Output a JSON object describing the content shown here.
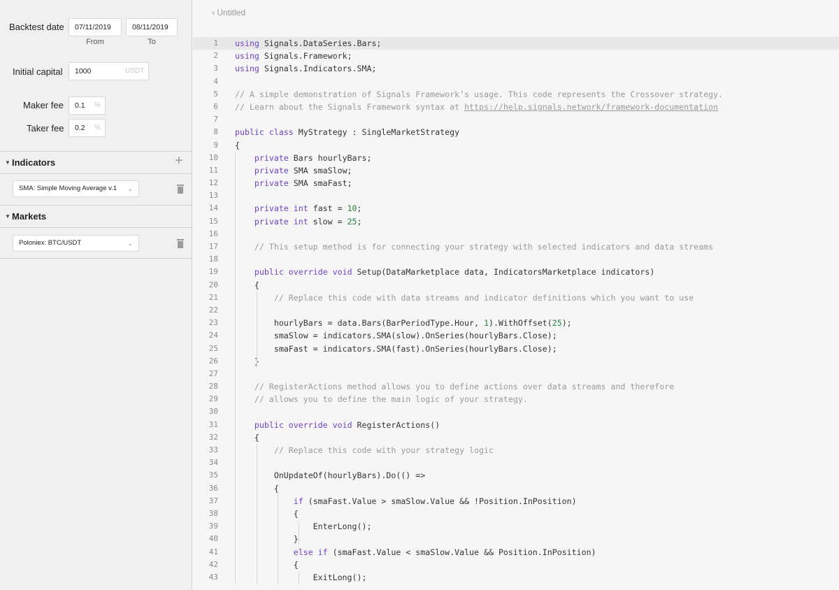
{
  "sidebar": {
    "backtest": {
      "label": "Backtest date",
      "from_value": "07/11/2019",
      "to_value": "08/11/2019",
      "from_sub": "From",
      "to_sub": "To"
    },
    "capital": {
      "label": "Initial capital",
      "value": "1000",
      "unit": "USDT"
    },
    "maker": {
      "label": "Maker fee",
      "value": "0.1",
      "unit": "%"
    },
    "taker": {
      "label": "Taker fee",
      "value": "0.2",
      "unit": "%"
    },
    "indicators": {
      "title": "Indicators",
      "add": "+",
      "selected": "SMA: Simple Moving Average v.1"
    },
    "markets": {
      "title": "Markets",
      "selected": "Poloniex: BTC/USDT"
    }
  },
  "editor": {
    "file_tab": "‹ Untitled",
    "active_line": 1,
    "lines": [
      "using Signals.DataSeries.Bars;",
      "using Signals.Framework;",
      "using Signals.Indicators.SMA;",
      "",
      "// A simple demonstration of Signals Framework’s usage. This code represents the Crossover strategy.",
      "// Learn about the Signals Framework syntax at https://help.signals.network/framework-documentation",
      "",
      "public class MyStrategy : SingleMarketStrategy",
      "{",
      "    private Bars hourlyBars;",
      "    private SMA smaSlow;",
      "    private SMA smaFast;",
      "",
      "    private int fast = 10;",
      "    private int slow = 25;",
      "",
      "    // This setup method is for connecting your strategy with selected indicators and data streams",
      "",
      "    public override void Setup(DataMarketplace data, IndicatorsMarketplace indicators)",
      "    {",
      "        // Replace this code with data streams and indicator definitions which you want to use",
      "",
      "        hourlyBars = data.Bars(BarPeriodType.Hour, 1).WithOffset(25);",
      "        smaSlow = indicators.SMA(slow).OnSeries(hourlyBars.Close);",
      "        smaFast = indicators.SMA(fast).OnSeries(hourlyBars.Close);",
      "    }",
      "",
      "    // RegisterActions method allows you to define actions over data streams and therefore",
      "    // allows you to define the main logic of your strategy.",
      "",
      "    public override void RegisterActions()",
      "    {",
      "        // Replace this code with your strategy logic",
      "",
      "        OnUpdateOf(hourlyBars).Do(() =>",
      "        {",
      "            if (smaFast.Value > smaSlow.Value && !Position.InPosition)",
      "            {",
      "                EnterLong();",
      "            }",
      "            else if (smaFast.Value < smaSlow.Value && Position.InPosition)",
      "            {",
      "                ExitLong();"
    ]
  }
}
